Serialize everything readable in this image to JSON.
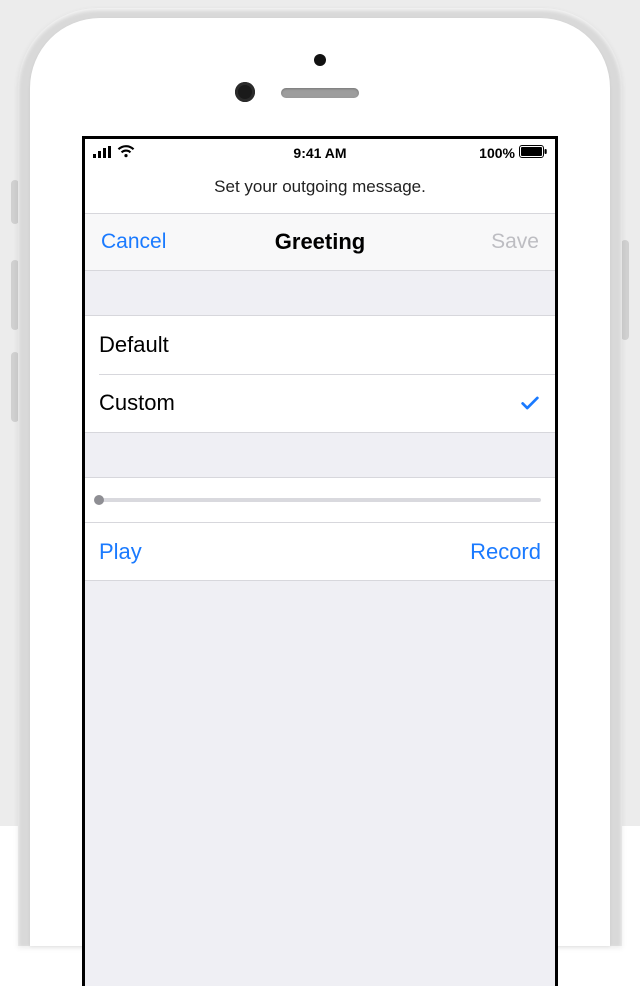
{
  "status_bar": {
    "time": "9:41 AM",
    "battery_text": "100%"
  },
  "instruction": "Set your outgoing message.",
  "navbar": {
    "left_label": "Cancel",
    "title": "Greeting",
    "right_label": "Save",
    "right_enabled": false
  },
  "options": {
    "default_label": "Default",
    "custom_label": "Custom",
    "selected": "custom"
  },
  "playback": {
    "progress": 0
  },
  "actions": {
    "play_label": "Play",
    "record_label": "Record"
  },
  "colors": {
    "tint": "#1a7aff",
    "background_grouped": "#efeff4",
    "separator": "#d7d7dc",
    "disabled_text": "#bdbdc2"
  }
}
